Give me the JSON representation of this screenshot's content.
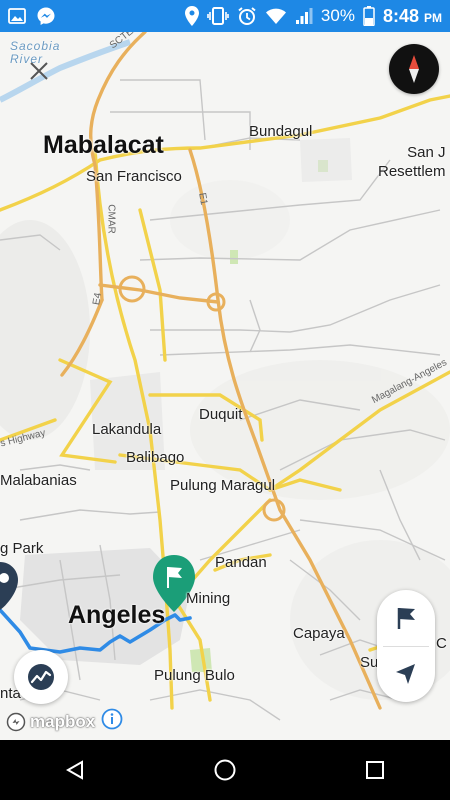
{
  "status_bar": {
    "battery_percent": "30%",
    "time": "8:48",
    "ampm": "PM",
    "icons": [
      "gallery-icon",
      "messenger-icon",
      "location-icon",
      "vibrate-icon",
      "alarm-icon",
      "wifi-icon",
      "signal-icon",
      "battery-icon"
    ]
  },
  "map": {
    "places": {
      "sacobia_river": "Sacobia\nRiver",
      "mabalacat": "Mabalacat",
      "bundagul": "Bundagul",
      "san_francisco": "San Francisco",
      "san_resettlement": "San J\nResettlem",
      "duquit": "Duquit",
      "lakandula": "Lakandula",
      "balibago": "Balibago",
      "malabanias": "Malabanias",
      "pulung_maragul": "Pulung Maragul",
      "pandan": "Pandan",
      "park": "g Park",
      "angeles": "Angeles",
      "mining": "Mining",
      "capaya": "Capaya",
      "pulung_bulo": "Pulung Bulo",
      "santa": "nta",
      "su": "Su"
    },
    "road_labels": {
      "sctex": "SCTEX",
      "e1": "E1",
      "cmar": "CMAR",
      "e4": "E4",
      "magalang_angeles": "Magalang-Angeles",
      "highway": "s Highway"
    },
    "colors": {
      "land": "#f5f5f3",
      "minor_road": "#c6c6c6",
      "primary_road": "#f2d24a",
      "motorway": "#e8b05c",
      "route": "#2f8be6",
      "destination_marker": "#1b9e78"
    }
  },
  "controls": {
    "compass_icon": "compass-icon",
    "close_icon": "close-icon",
    "flag_icon": "flag-icon",
    "navigate_icon": "navigation-arrow-icon",
    "trend_icon": "route-overview-icon"
  },
  "attribution": {
    "logo_text": "mapbox",
    "info_icon": "info-icon"
  },
  "nav_bar": {
    "back": "back-icon",
    "home": "home-icon",
    "recents": "recents-icon"
  }
}
